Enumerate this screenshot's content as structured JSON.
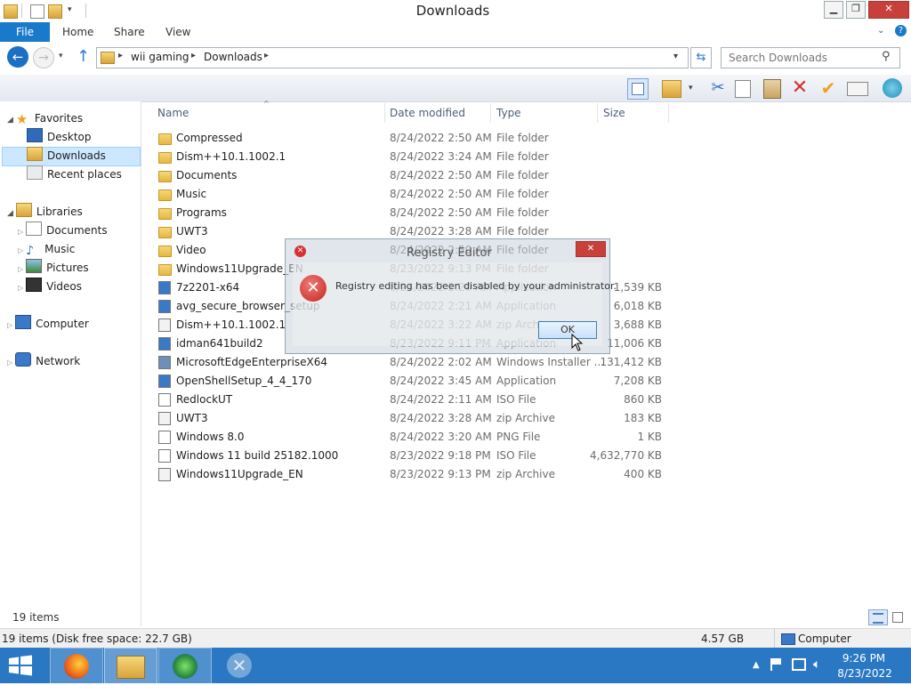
{
  "window": {
    "title": "Downloads"
  },
  "ribbon": {
    "file": "File",
    "tabs": [
      "Home",
      "Share",
      "View"
    ]
  },
  "address": {
    "crumbs": [
      "wii gaming",
      "Downloads"
    ],
    "search_placeholder": "Search Downloads"
  },
  "nav": {
    "favorites": "Favorites",
    "fav_items": [
      "Desktop",
      "Downloads",
      "Recent places"
    ],
    "libraries": "Libraries",
    "lib_items": [
      "Documents",
      "Music",
      "Pictures",
      "Videos"
    ],
    "computer": "Computer",
    "network": "Network"
  },
  "columns": {
    "name": "Name",
    "date": "Date modified",
    "type": "Type",
    "size": "Size"
  },
  "files": [
    {
      "name": "Compressed",
      "date": "8/24/2022 2:50 AM",
      "type": "File folder",
      "size": "",
      "icon": "folder"
    },
    {
      "name": "Dism++10.1.1002.1",
      "date": "8/24/2022 3:24 AM",
      "type": "File folder",
      "size": "",
      "icon": "folder"
    },
    {
      "name": "Documents",
      "date": "8/24/2022 2:50 AM",
      "type": "File folder",
      "size": "",
      "icon": "folder"
    },
    {
      "name": "Music",
      "date": "8/24/2022 2:50 AM",
      "type": "File folder",
      "size": "",
      "icon": "folder"
    },
    {
      "name": "Programs",
      "date": "8/24/2022 2:50 AM",
      "type": "File folder",
      "size": "",
      "icon": "folder"
    },
    {
      "name": "UWT3",
      "date": "8/24/2022 3:28 AM",
      "type": "File folder",
      "size": "",
      "icon": "folder"
    },
    {
      "name": "Video",
      "date": "8/24/2022 2:50 AM",
      "type": "File folder",
      "size": "",
      "icon": "folder"
    },
    {
      "name": "Windows11Upgrade_EN",
      "date": "8/23/2022 9:13 PM",
      "type": "File folder",
      "size": "",
      "icon": "folder"
    },
    {
      "name": "7z2201-x64",
      "date": "8/24/2022 2:20 AM",
      "type": "Application",
      "size": "1,539 KB",
      "icon": "app"
    },
    {
      "name": "avg_secure_browser_setup",
      "date": "8/24/2022 2:21 AM",
      "type": "Application",
      "size": "6,018 KB",
      "icon": "app"
    },
    {
      "name": "Dism++10.1.1002.1",
      "date": "8/24/2022 3:22 AM",
      "type": "zip Archive",
      "size": "3,688 KB",
      "icon": "zip"
    },
    {
      "name": "idman641build2",
      "date": "8/23/2022 9:11 PM",
      "type": "Application",
      "size": "11,006 KB",
      "icon": "app"
    },
    {
      "name": "MicrosoftEdgeEnterpriseX64",
      "date": "8/24/2022 2:02 AM",
      "type": "Windows Installer ...",
      "size": "131,412 KB",
      "icon": "msi"
    },
    {
      "name": "OpenShellSetup_4_4_170",
      "date": "8/24/2022 3:45 AM",
      "type": "Application",
      "size": "7,208 KB",
      "icon": "app"
    },
    {
      "name": "RedlockUT",
      "date": "8/24/2022 2:11 AM",
      "type": "ISO File",
      "size": "860 KB",
      "icon": "file"
    },
    {
      "name": "UWT3",
      "date": "8/24/2022 3:28 AM",
      "type": "zip Archive",
      "size": "183 KB",
      "icon": "zip"
    },
    {
      "name": "Windows 8.0",
      "date": "8/24/2022 3:20 AM",
      "type": "PNG File",
      "size": "1 KB",
      "icon": "file"
    },
    {
      "name": "Windows 11 build 25182.1000",
      "date": "8/23/2022 9:18 PM",
      "type": "ISO File",
      "size": "4,632,770 KB",
      "icon": "file"
    },
    {
      "name": "Windows11Upgrade_EN",
      "date": "8/23/2022 9:13 PM",
      "type": "zip Archive",
      "size": "400 KB",
      "icon": "zip"
    }
  ],
  "status": {
    "items": "19 items",
    "disk": "19 items (Disk free space: 22.7 GB)",
    "size": "4.57 GB",
    "location": "Computer"
  },
  "dialog": {
    "title": "Registry Editor",
    "message": "Registry editing has been disabled by your administrator.",
    "ok": "OK"
  },
  "clock": {
    "time": "9:26 PM",
    "date": "8/23/2022"
  },
  "colors": {
    "accent": "#1979ca",
    "taskbar": "#2a78c4",
    "selected": "#cce8ff",
    "error": "#d9302f"
  }
}
